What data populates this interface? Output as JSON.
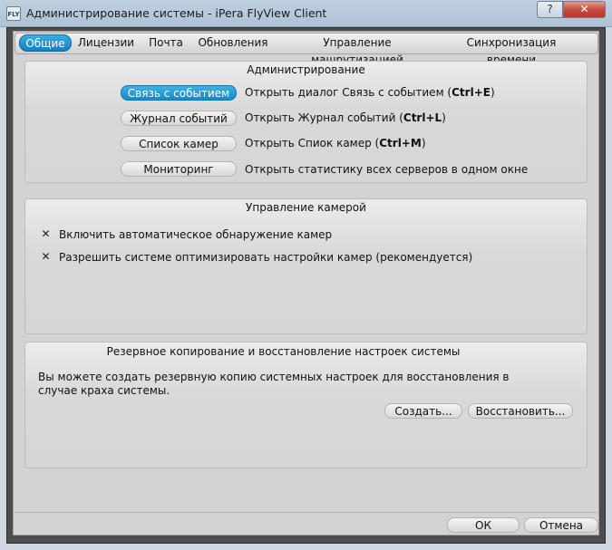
{
  "window": {
    "title": "Администрирование системы - iPera FlyView Client",
    "icon_label": "FLY",
    "help_label": "?",
    "close_label": "✕"
  },
  "tabs": [
    {
      "label": "Общие",
      "active": true
    },
    {
      "label": "Лицензии",
      "active": false
    },
    {
      "label": "Почта",
      "active": false
    },
    {
      "label": "Обновления",
      "active": false
    },
    {
      "label": "Управление машрутизацией",
      "active": false
    },
    {
      "label": "Синхронизация времени",
      "active": false
    }
  ],
  "admin": {
    "title": "Администрирование",
    "rows": [
      {
        "button": "Связь с событием",
        "text": "Открыть диалог Связь с событием (",
        "shortcut": "Ctrl+E",
        "tail": ")"
      },
      {
        "button": "Журнал событий",
        "text": "Открыть Журнал событий (",
        "shortcut": "Ctrl+L",
        "tail": ")"
      },
      {
        "button": "Список камер",
        "text": "Открыть Спиок камер (",
        "shortcut": "Ctrl+M",
        "tail": ")"
      },
      {
        "button": "Мониторинг",
        "text": "Открыть статистику всех серверов в одном окне",
        "shortcut": "",
        "tail": ""
      }
    ]
  },
  "camera": {
    "title": "Управление камерой",
    "options": [
      {
        "label": "Включить автоматическое обнаружение камер",
        "checked": true
      },
      {
        "label": "Разрешить системе оптимизировать настройки камер (рекомендуется)",
        "checked": true
      }
    ]
  },
  "backup": {
    "title": "Резервное копирование и восстановление настроек системы",
    "text": "Вы можете создать резервную копию системных настроек для восстановления в случае краха системы.",
    "create_label": "Создать...",
    "restore_label": "Восстановить..."
  },
  "footer": {
    "ok_label": "ОК",
    "cancel_label": "Отмена"
  }
}
